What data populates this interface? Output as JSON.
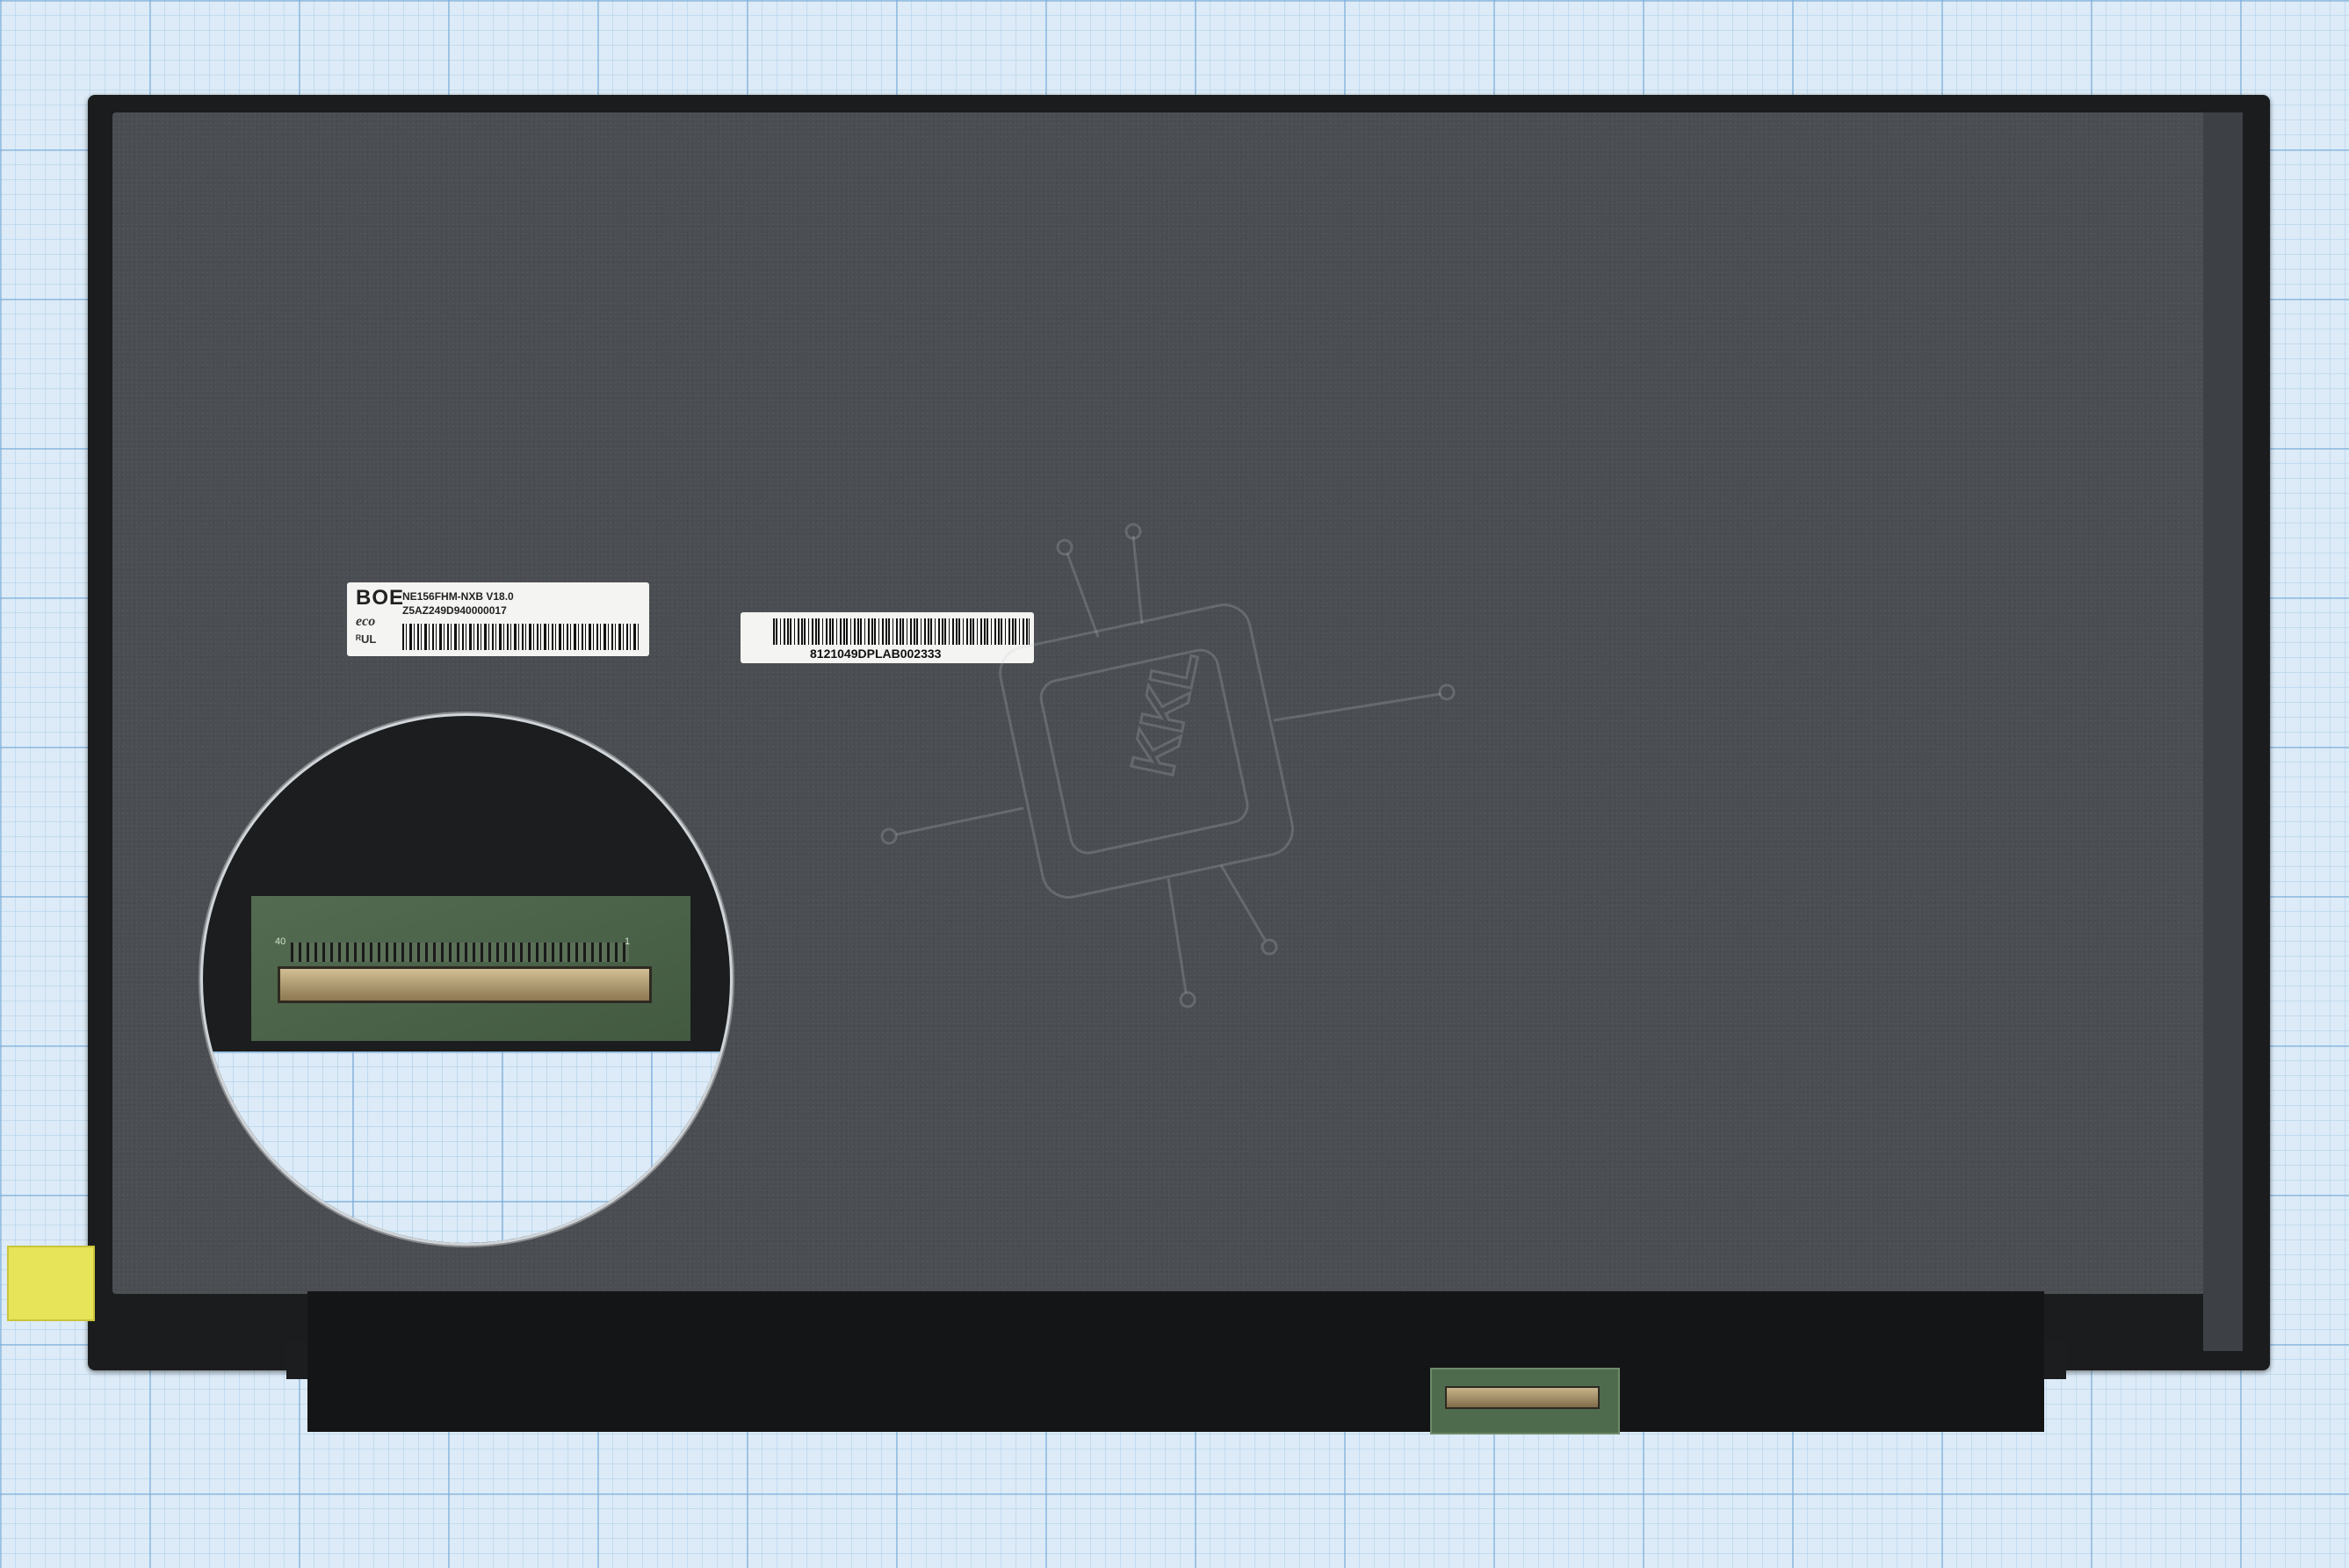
{
  "labels": {
    "boe": {
      "logo": "BOE",
      "model": "NE156FHM-NXB V18.0",
      "serial": "Z5AZ249D940000017",
      "eco": "eco",
      "ul": "ᴿUL"
    },
    "serial_sticker": {
      "text": "8121049DPLAB002333"
    },
    "zoom_pins": {
      "left": "40",
      "right": "1"
    }
  },
  "watermark": {
    "text": "KKL"
  },
  "colors": {
    "panel_back": "#4a4d51",
    "bezel": "#1b1c1d",
    "grid_paper": "#dcebf7",
    "pcb_green": "#4a6448",
    "tape_yellow": "#e8e45a"
  }
}
